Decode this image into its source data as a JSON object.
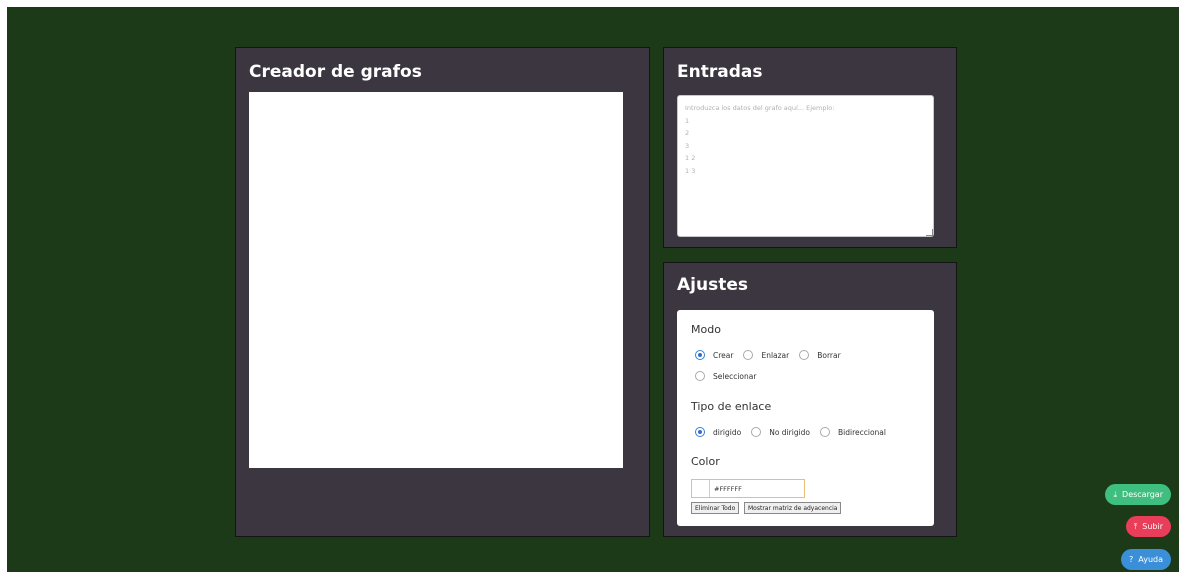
{
  "graph_panel": {
    "title": "Creador de grafos"
  },
  "input_panel": {
    "title": "Entradas",
    "placeholder": "Introduzca los datos del grafo aquí... Ejemplo:\n1\n2\n3\n1 2\n1 3"
  },
  "settings_panel": {
    "title": "Ajustes",
    "mode": {
      "label": "Modo",
      "options": [
        "Crear",
        "Enlazar",
        "Borrar",
        "Seleccionar"
      ],
      "selected": "Crear"
    },
    "link_type": {
      "label": "Tipo de enlace",
      "options": [
        "dirigido",
        "No dirigido",
        "Bidireccional"
      ],
      "selected": "dirigido"
    },
    "color": {
      "label": "Color",
      "value": "#FFFFFF"
    },
    "buttons": {
      "delete_all": "Eliminar Todo",
      "show_matrix": "Mostrar matriz de adyacencia"
    }
  },
  "floating_buttons": {
    "download": "Descargar",
    "upload": "Subir",
    "help": "Ayuda"
  },
  "colors": {
    "background": "#1c3a18",
    "panel": "#3b3640",
    "download": "#3fbf7f",
    "upload": "#e83e5a",
    "help": "#3a8fd8"
  },
  "icons": {
    "download": "download-icon",
    "upload": "upload-icon",
    "help": "question-icon"
  }
}
